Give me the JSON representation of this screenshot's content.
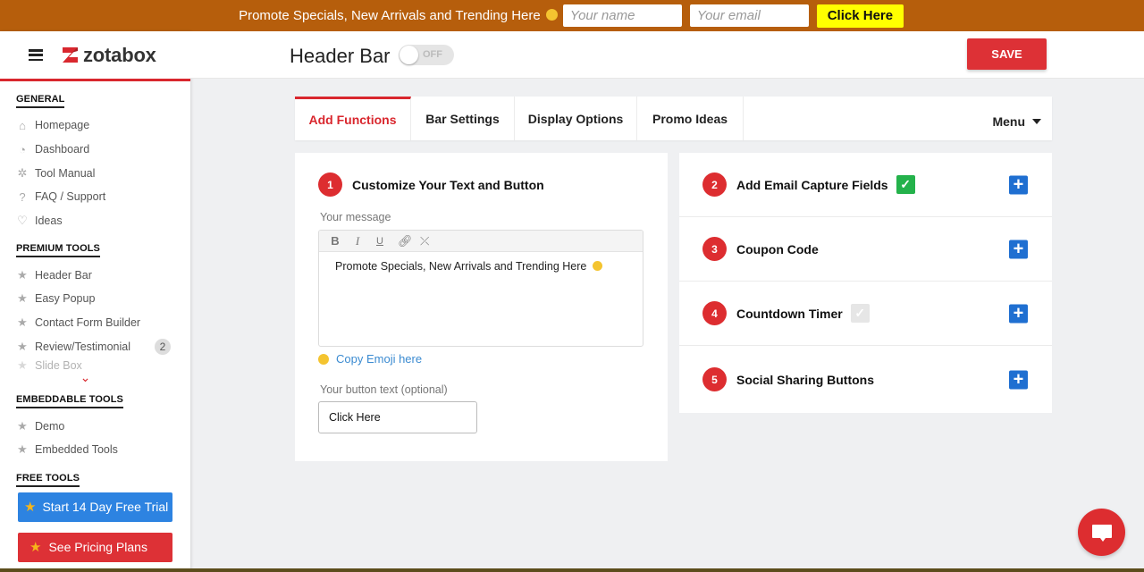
{
  "promo_bar": {
    "message": "Promote Specials, New Arrivals and Trending Here",
    "emoji_icon": "smiley-emoji",
    "name_placeholder": "Your name",
    "email_placeholder": "Your email",
    "cta_label": "Click Here",
    "bg_color": "#b65e0c",
    "cta_color": "#ffff00"
  },
  "sidebar": {
    "logo_text": "zotabox",
    "sections": [
      {
        "title": "GENERAL",
        "items": [
          {
            "label": "Homepage",
            "icon": "home-icon"
          },
          {
            "label": "Dashboard",
            "icon": "gauge-icon"
          },
          {
            "label": "Tool Manual",
            "icon": "gear-icon"
          },
          {
            "label": "FAQ / Support",
            "icon": "question-icon"
          },
          {
            "label": "Ideas",
            "icon": "lightbulb-icon"
          }
        ]
      },
      {
        "title": "PREMIUM TOOLS",
        "items": [
          {
            "label": "Header Bar",
            "icon": "star-icon"
          },
          {
            "label": "Easy Popup",
            "icon": "star-icon"
          },
          {
            "label": "Contact Form Builder",
            "icon": "star-icon"
          },
          {
            "label": "Review/Testimonial",
            "icon": "star-icon",
            "badge": "2"
          },
          {
            "label": "Slide Box",
            "icon": "star-icon"
          }
        ]
      },
      {
        "title": "EMBEDDABLE TOOLS",
        "items": [
          {
            "label": "Demo",
            "icon": "star-icon"
          },
          {
            "label": "Embedded Tools",
            "icon": "star-icon"
          }
        ]
      },
      {
        "title": "FREE TOOLS",
        "items": []
      }
    ],
    "trial_button": "Start 14 Day Free Trial",
    "pricing_button": "See Pricing Plans"
  },
  "header": {
    "title": "Header Bar",
    "toggle_label": "OFF",
    "toggle_on": false,
    "save_label": "SAVE",
    "accent_color": "#dd3136"
  },
  "tabs": {
    "items": [
      {
        "label": "Add Functions",
        "active": true
      },
      {
        "label": "Bar Settings",
        "active": false
      },
      {
        "label": "Display Options",
        "active": false
      },
      {
        "label": "Promo Ideas",
        "active": false
      }
    ],
    "menu_label": "Menu"
  },
  "customize": {
    "step": "1",
    "title": "Customize Your Text and Button",
    "message_label": "Your message",
    "toolbar": [
      "B",
      "I",
      "U",
      "link",
      "unlink"
    ],
    "message_value": "Promote Specials, New Arrivals and Trending Here",
    "copy_emoji_label": "Copy Emoji here",
    "button_label": "Your button text (optional)",
    "button_value": "Click Here"
  },
  "functions": [
    {
      "step": "2",
      "title": "Add Email Capture Fields",
      "checked": "on"
    },
    {
      "step": "3",
      "title": "Coupon Code",
      "checked": "none"
    },
    {
      "step": "4",
      "title": "Countdown Timer",
      "checked": "off"
    },
    {
      "step": "5",
      "title": "Social Sharing Buttons",
      "checked": "none"
    }
  ]
}
